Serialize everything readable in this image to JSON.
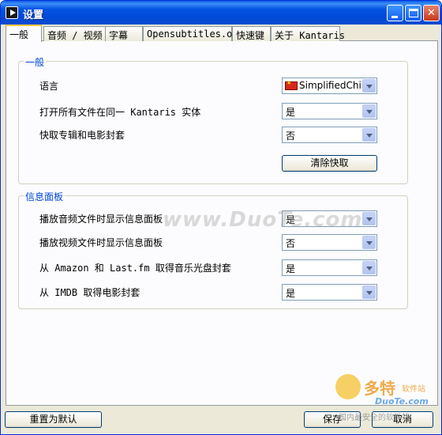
{
  "window": {
    "title": "设置"
  },
  "tabs": [
    "一般",
    "音频 / 视频",
    "字幕",
    "Opensubtitles.org",
    "快速键",
    "关于 Kantaris"
  ],
  "general": {
    "title": "一般",
    "language_label": "语言",
    "language_value": "SimplifiedChin",
    "open_label": "打开所有文件在同一 Kantaris 实体",
    "open_value": "是",
    "fetch_label": "快取专辑和电影封套",
    "fetch_value": "否",
    "clear_cache": "清除快取"
  },
  "info": {
    "title": "信息面板",
    "audio_label": "播放音频文件时显示信息面板",
    "audio_value": "是",
    "video_label": "播放视频文件时显示信息面板",
    "video_value": "否",
    "amazon_label": "从 Amazon 和 Last.fm 取得音乐光盘封套",
    "amazon_value": "是",
    "imdb_label": "从 IMDB 取得电影封套",
    "imdb_value": "是"
  },
  "footer": {
    "reset": "重置为默认",
    "save": "保存",
    "cancel": "取消"
  },
  "watermark": {
    "text": "www.DuoTe.com",
    "logo_cn": "多特",
    "logo_small": "软件站",
    "logo_url": "DuoTe.com",
    "logo_bottom": "国内最安全的软件站"
  }
}
